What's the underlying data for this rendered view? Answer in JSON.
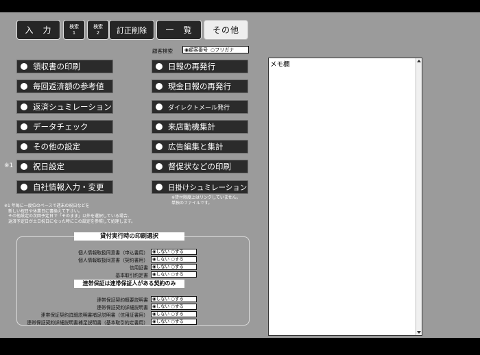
{
  "tabs": [
    {
      "label": "入　力"
    },
    {
      "label": "検索\n1"
    },
    {
      "label": "検索\n2"
    },
    {
      "label": "訂正削除"
    },
    {
      "label": "一　覧"
    },
    {
      "label": "その他"
    }
  ],
  "search": {
    "label": "顧客検索",
    "option1": "◉顧客番号",
    "option2": "○フリガナ"
  },
  "left_menu": [
    "領収書の印刷",
    "毎回返済額の参考値",
    "返済シュミレーション",
    "データチェック",
    "その他の設定",
    "祝日設定",
    "自社情報入力・変更"
  ],
  "right_menu": [
    "日報の再発行",
    "現金日報の再発行",
    "ダイレクトメール発行",
    "来店動機集計",
    "広告編集と集計",
    "督促状などの印刷",
    "日掛けシュミレーション"
  ],
  "mark_holiday": "※1",
  "note_right": [
    "※貸付限度上はリンクしていません。",
    "単独のファイルです。"
  ],
  "note_left": [
    "※1 年毎に一度位のペースで週末の祝日などを",
    "　新しい祝日や休業日に書換えて下さい。",
    "　その他設定の次回予定日で「そのまま」以外を選択している場合、",
    "　返済予定日が土日祝日になった時にこの設定を参照して処理します。"
  ],
  "memo": {
    "label": "メモ欄"
  },
  "print_settings": {
    "title": "貸付実行時の印刷選択",
    "rows": [
      "個人情報取扱同意書（申込書用）",
      "個人情報取扱同意書（契約書用）",
      "信用証書",
      "基本取引約定書"
    ],
    "option": "◉しない ○する"
  },
  "guarantor_settings": {
    "title": "連帯保証は連帯保証人がある契約のみ",
    "rows": [
      "連帯保証契約概要説明書",
      "連帯保証契約詳細説明書",
      "連帯保証契約詳細説明書補足説明書（信用証書用）",
      "連帯保証契約詳細説明書補足説明書（基本取引約定書用）"
    ],
    "option": "◉しない ○する"
  }
}
